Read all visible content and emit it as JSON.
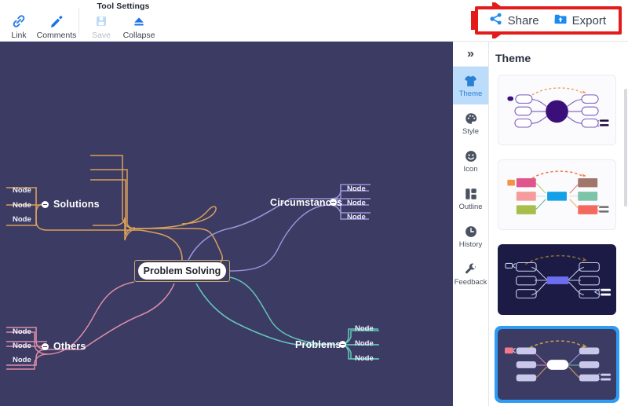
{
  "toolbar": {
    "left_tools": [
      {
        "label": "Link",
        "icon": "link-icon"
      },
      {
        "label": "Comments",
        "icon": "comment-pen-icon"
      }
    ],
    "group_title": "Tool Settings",
    "settings_tools": [
      {
        "label": "Save",
        "icon": "save-lock-icon",
        "disabled": true
      },
      {
        "label": "Collapse",
        "icon": "collapse-eject-icon",
        "disabled": false
      }
    ],
    "right_actions": [
      {
        "label": "Share",
        "icon": "share-nodes-icon"
      },
      {
        "label": "Export",
        "icon": "export-upload-icon"
      }
    ],
    "highlight_color": "#e31b1b",
    "annotation_arrow": "red-right-arrow"
  },
  "canvas": {
    "background": "#3b3b63",
    "root": {
      "label": "Problem Solving",
      "selected": true
    },
    "branches": [
      {
        "label": "Solutions",
        "color": "#d9a05b",
        "side": "left",
        "position": "top",
        "children": [
          {
            "label": "Node"
          },
          {
            "label": "Node"
          },
          {
            "label": "Node"
          }
        ]
      },
      {
        "label": "Circumstances",
        "color": "#9a93d6",
        "side": "right",
        "position": "top",
        "children": [
          {
            "label": "Node"
          },
          {
            "label": "Node"
          },
          {
            "label": "Node"
          }
        ]
      },
      {
        "label": "Others",
        "color": "#d98ca8",
        "side": "left",
        "position": "bottom",
        "children": [
          {
            "label": "Node"
          },
          {
            "label": "Node"
          },
          {
            "label": "Node"
          }
        ]
      },
      {
        "label": "Problems",
        "color": "#63c4b8",
        "side": "right",
        "position": "bottom",
        "children": [
          {
            "label": "Node"
          },
          {
            "label": "Node"
          },
          {
            "label": "Node"
          }
        ]
      }
    ]
  },
  "rail": {
    "collapse_label": "»",
    "items": [
      {
        "label": "Theme",
        "icon": "tshirt-icon",
        "active": true
      },
      {
        "label": "Style",
        "icon": "palette-icon",
        "active": false
      },
      {
        "label": "Icon",
        "icon": "smiley-icon",
        "active": false
      },
      {
        "label": "Outline",
        "icon": "grid-icon",
        "active": false
      },
      {
        "label": "History",
        "icon": "clock-icon",
        "active": false
      },
      {
        "label": "Feedback",
        "icon": "wrench-icon",
        "active": false
      }
    ]
  },
  "panel": {
    "title": "Theme",
    "themes": [
      {
        "name": "classic-purple-light",
        "style": "light",
        "selected": false,
        "center_color": "#3b0f7a",
        "node_stroke": "#7a5bbf",
        "node_fill": "#ffffff",
        "arc_color": "#f0a05a"
      },
      {
        "name": "colorful-light",
        "style": "light",
        "selected": false,
        "center_color": "#14a0e8",
        "node_stroke": "#d0606f",
        "node_fill": "#ffffff",
        "arc_color": "#f07a45"
      },
      {
        "name": "deep-navy",
        "style": "dark1",
        "selected": false,
        "center_color": "#6d6df0",
        "node_stroke": "#c8cbe8",
        "node_fill": "#1b1b46",
        "arc_color": "#8a6a3a"
      },
      {
        "name": "navy-lavender",
        "style": "dark2",
        "selected": true,
        "center_color": "#ffffff",
        "node_stroke": "#cfcdf0",
        "node_fill": "#c9c7ea",
        "arc_color": "#c8a04a"
      }
    ]
  }
}
